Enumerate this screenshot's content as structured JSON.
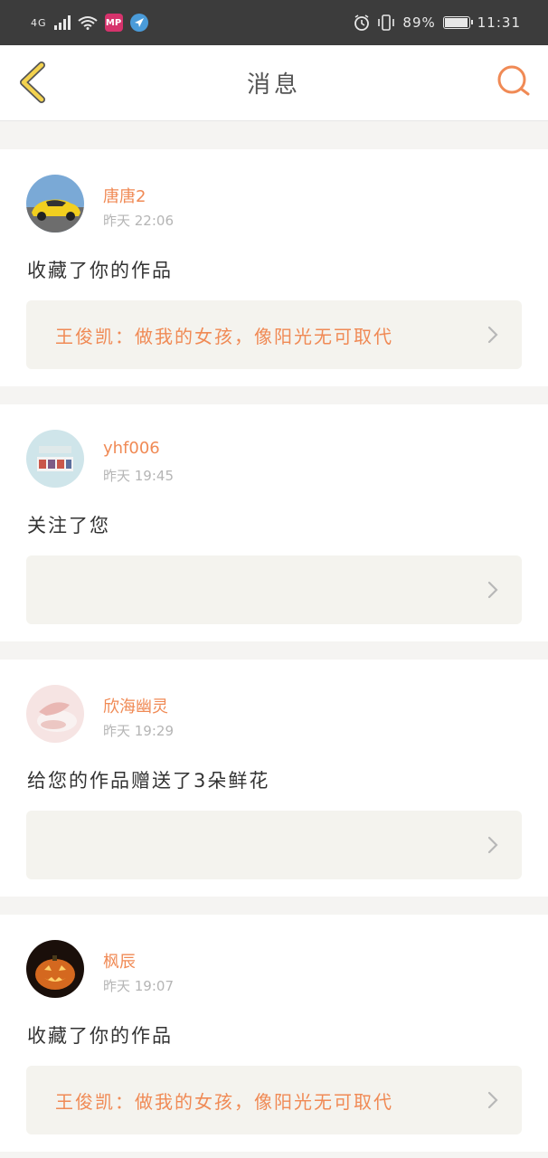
{
  "status_bar": {
    "network": "4G",
    "app_badge": "MP",
    "battery": "89%",
    "battery_level": 0.89,
    "time": "11:31",
    "icons": [
      "signal-icon",
      "wifi-icon",
      "app-badge-icon",
      "navigation-icon",
      "alarm-icon",
      "vibrate-icon",
      "battery-icon"
    ]
  },
  "header": {
    "title": "消息",
    "back_icon": "chevron-left-icon",
    "search_icon": "search-icon",
    "accent_color": "#f08a55",
    "back_color": "#f3d24e"
  },
  "messages": [
    {
      "user": "唐唐2",
      "time": "昨天 22:06",
      "action": "收藏了你的作品",
      "work": "王俊凯：做我的女孩，像阳光无可取代",
      "avatar": "yellow-sports-car"
    },
    {
      "user": "yhf006",
      "time": "昨天 19:45",
      "action": "关注了您",
      "work": "",
      "avatar": "photo-strip"
    },
    {
      "user": "欣海幽灵",
      "time": "昨天 19:29",
      "action": "给您的作品赠送了3朵鲜花",
      "work": "",
      "avatar": "pink-teacup"
    },
    {
      "user": "枫辰",
      "time": "昨天 19:07",
      "action": "收藏了你的作品",
      "work": "王俊凯：做我的女孩，像阳光无可取代",
      "avatar": "pumpkin-lantern"
    }
  ]
}
